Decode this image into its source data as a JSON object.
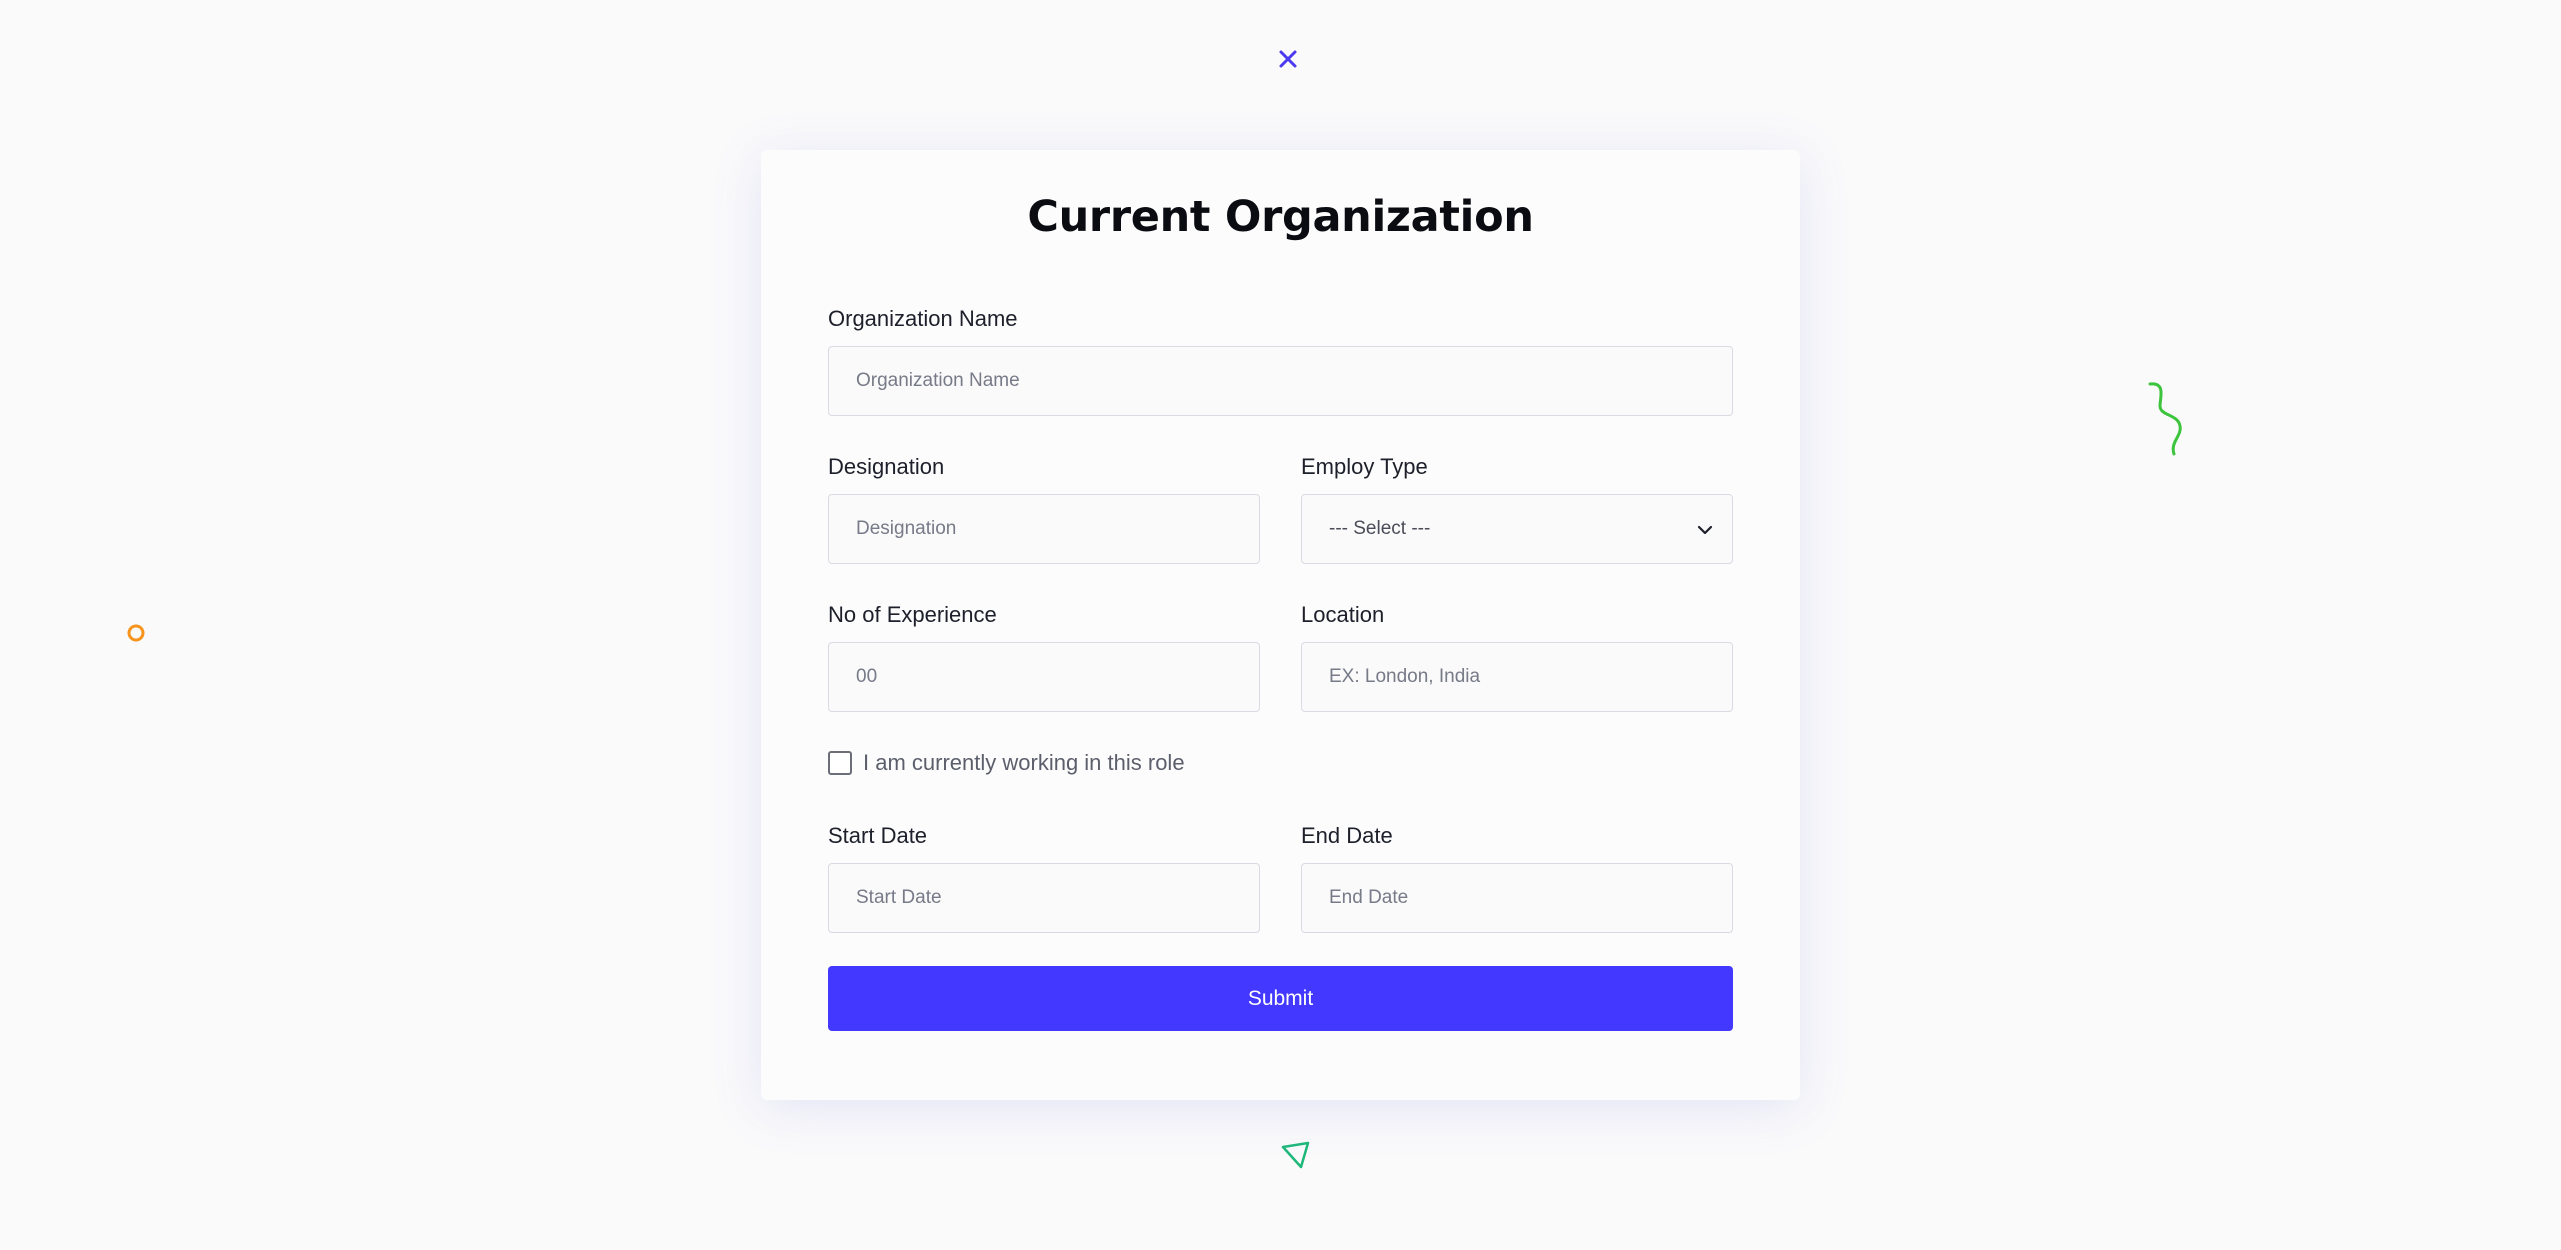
{
  "form": {
    "title": "Current Organization",
    "organization_name": {
      "label": "Organization Name",
      "placeholder": "Organization Name",
      "value": ""
    },
    "designation": {
      "label": "Designation",
      "placeholder": "Designation",
      "value": ""
    },
    "employ_type": {
      "label": "Employ Type",
      "selected": "--- Select ---"
    },
    "experience": {
      "label": "No of Experience",
      "placeholder": "00",
      "value": ""
    },
    "location": {
      "label": "Location",
      "placeholder": "EX: London, India",
      "value": ""
    },
    "currently_working": {
      "label": "I am currently working in this role",
      "checked": false
    },
    "start_date": {
      "label": "Start Date",
      "placeholder": "Start Date",
      "value": ""
    },
    "end_date": {
      "label": "End Date",
      "placeholder": "End Date",
      "value": ""
    },
    "submit_label": "Submit"
  },
  "decorations": {
    "x_icon": "close-x-icon",
    "squiggle_icon": "squiggle-icon",
    "circle_icon": "circle-outline-icon",
    "triangle_icon": "triangle-outline-icon"
  },
  "colors": {
    "primary": "#4338ff",
    "x_deco": "#4b3af0",
    "squiggle_deco": "#3cc43c",
    "circle_deco": "#f7941d",
    "triangle_deco": "#1fb87a"
  }
}
